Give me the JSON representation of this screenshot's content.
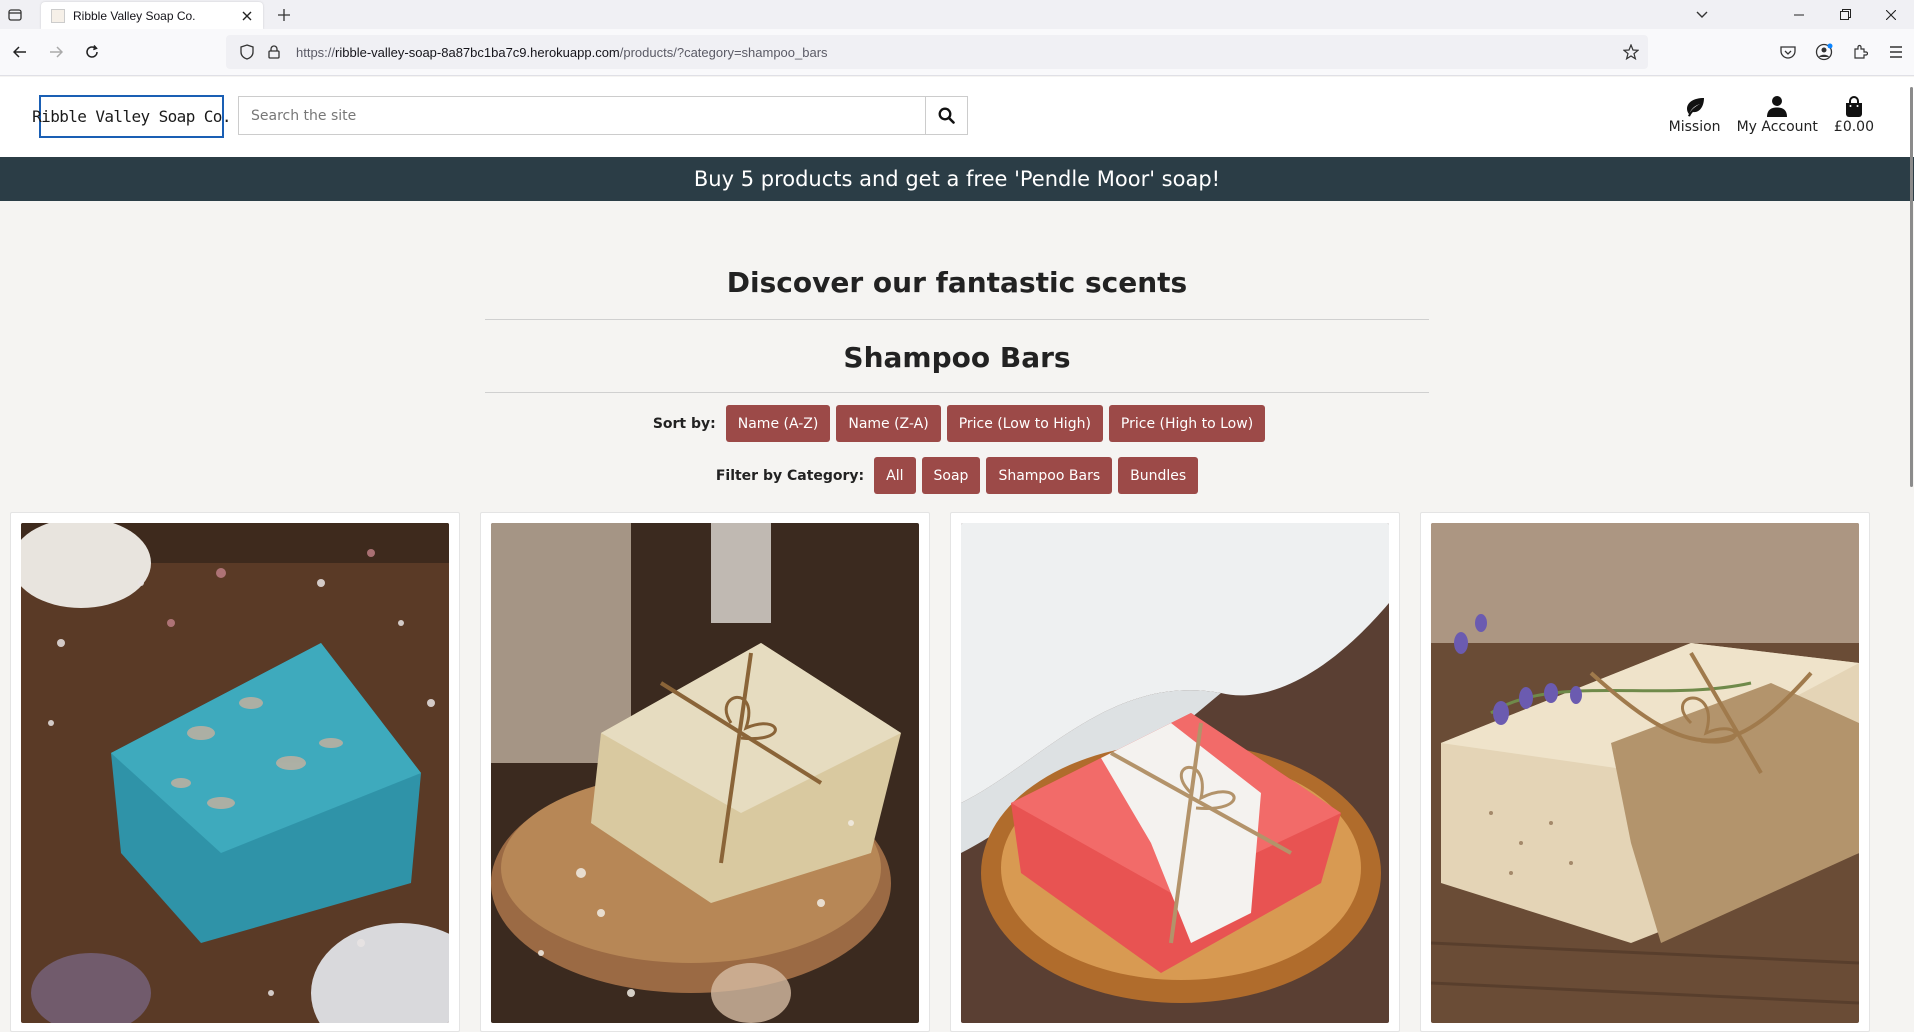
{
  "browser": {
    "tab_title": "Ribble Valley Soap Co.",
    "url_prefix": "https://",
    "url_host": "ribble-valley-soap-8a87bc1ba7c9.herokuapp.com",
    "url_path": "/products/?category=shampoo_bars"
  },
  "header": {
    "logo_text": "Ribble Valley Soap Co.",
    "search_placeholder": "Search the site",
    "links": {
      "mission": "Mission",
      "account": "My Account",
      "bag_total": "£0.00"
    }
  },
  "banner": {
    "text": "Buy 5 products and get a free 'Pendle Moor' soap!"
  },
  "main": {
    "heading": "Discover our fantastic scents",
    "category_title": "Shampoo Bars",
    "sort": {
      "label": "Sort by:",
      "options": [
        "Name (A-Z)",
        "Name (Z-A)",
        "Price (Low to High)",
        "Price (High to Low)"
      ]
    },
    "filter": {
      "label": "Filter by Category:",
      "options": [
        "All",
        "Soap",
        "Shampoo Bars",
        "Bundles"
      ]
    }
  },
  "colors": {
    "banner_bg": "#2b3d46",
    "button_bg": "#9c4a48",
    "page_bg": "#f5f4f2"
  },
  "products": [
    {
      "image": "blue-soap-with-dried-flowers"
    },
    {
      "image": "cream-soap-tied-with-twine"
    },
    {
      "image": "red-white-soap-in-wooden-dish"
    },
    {
      "image": "lavender-soap-bars-with-twine"
    }
  ]
}
